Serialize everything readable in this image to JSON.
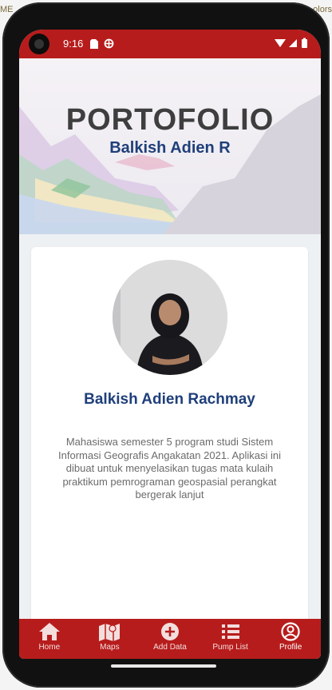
{
  "top_corner": {
    "left_text": "ME",
    "right_text": "olors"
  },
  "status_bar": {
    "time": "9:16"
  },
  "hero": {
    "title": "PORTOFOLIO",
    "subtitle": "Balkish Adien R"
  },
  "profile": {
    "name": "Balkish Adien Rachmay",
    "bio": "Mahasiswa semester 5 program studi Sistem Informasi Geografis Angakatan 2021. Aplikasi ini dibuat untuk menyelasikan tugas mata kulaih praktikum pemrograman geospasial perangkat bergerak lanjut"
  },
  "bottom_nav": {
    "items": [
      {
        "label": "Home",
        "icon": "home-icon"
      },
      {
        "label": "Maps",
        "icon": "map-icon"
      },
      {
        "label": "Add Data",
        "icon": "plus-circle-icon"
      },
      {
        "label": "Pump List",
        "icon": "list-icon"
      },
      {
        "label": "Profile",
        "icon": "user-circle-icon"
      }
    ],
    "active": "Profile"
  },
  "colors": {
    "primary": "#b71c1c",
    "heading_blue": "#1f3f7a",
    "title_gray": "#3e3e3e"
  }
}
